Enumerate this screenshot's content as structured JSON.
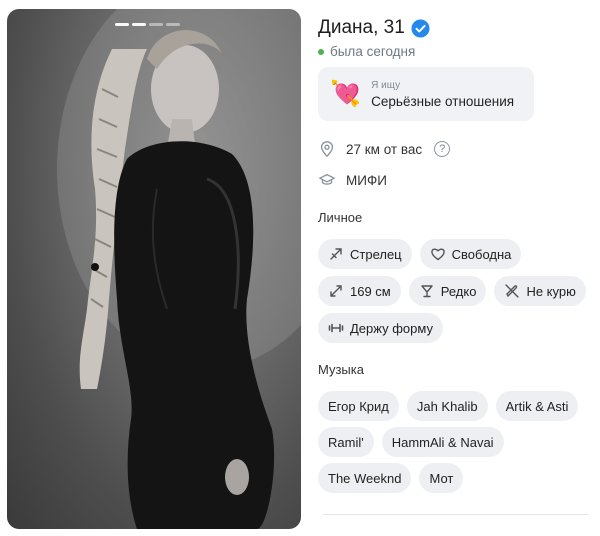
{
  "profile": {
    "name_age": "Диана, 31",
    "status": "была сегодня",
    "looking_for_label": "Я ищу",
    "looking_for_value": "Серьёзные отношения",
    "distance": "27 км от вас",
    "distance_help": "?",
    "university": "МИФИ"
  },
  "photo": {
    "indicators": 4,
    "active_indicator": 3
  },
  "personal": {
    "title": "Личное",
    "tags": [
      {
        "label": "Стрелец",
        "icon": "sagittarius-arrow-icon"
      },
      {
        "label": "Свободна",
        "icon": "heart-outline-icon"
      },
      {
        "label": "169 см",
        "icon": "height-arrows-icon"
      },
      {
        "label": "Редко",
        "icon": "glass-icon"
      },
      {
        "label": "Не курю",
        "icon": "no-smoking-icon"
      },
      {
        "label": "Держу форму",
        "icon": "dumbbell-icon"
      }
    ]
  },
  "music": {
    "title": "Музыка",
    "artists": [
      "Егор Крид",
      "Jah Khalib",
      "Artik & Asti",
      "Ramil'",
      "HammAli & Navai",
      "The Weeknd",
      "Мот"
    ]
  },
  "colors": {
    "accent": "#2688eb",
    "online": "#4bb34b",
    "chip_bg": "#edeff2",
    "card_bg": "#f0f2f5"
  }
}
